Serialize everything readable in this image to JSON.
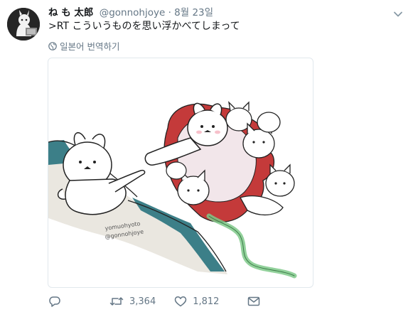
{
  "tweet": {
    "author_name": "ね も 太郎",
    "author_handle": "@gonnohjoye",
    "separator": "·",
    "timestamp": "8월 23일",
    "text": ">RT こういうものを思い浮かべてしまって",
    "translate_label": "일본어 번역하기"
  },
  "media": {
    "signature_line1": "yomuohyoto",
    "signature_line2": "@gonnohjoye"
  },
  "actions": {
    "reply_count": "",
    "retweet_count": "3,364",
    "like_count": "1,812"
  },
  "icons": [
    "avatar-icon",
    "chevron-down-icon",
    "globe-icon",
    "reply-icon",
    "retweet-icon",
    "like-icon",
    "dm-icon"
  ],
  "colors": {
    "text": "#14171a",
    "secondary": "#657786",
    "border": "#e1e8ed",
    "robe_red": "#c43a3a",
    "ground_teal": "#3c7f88",
    "sash_green": "#7fc98a"
  }
}
